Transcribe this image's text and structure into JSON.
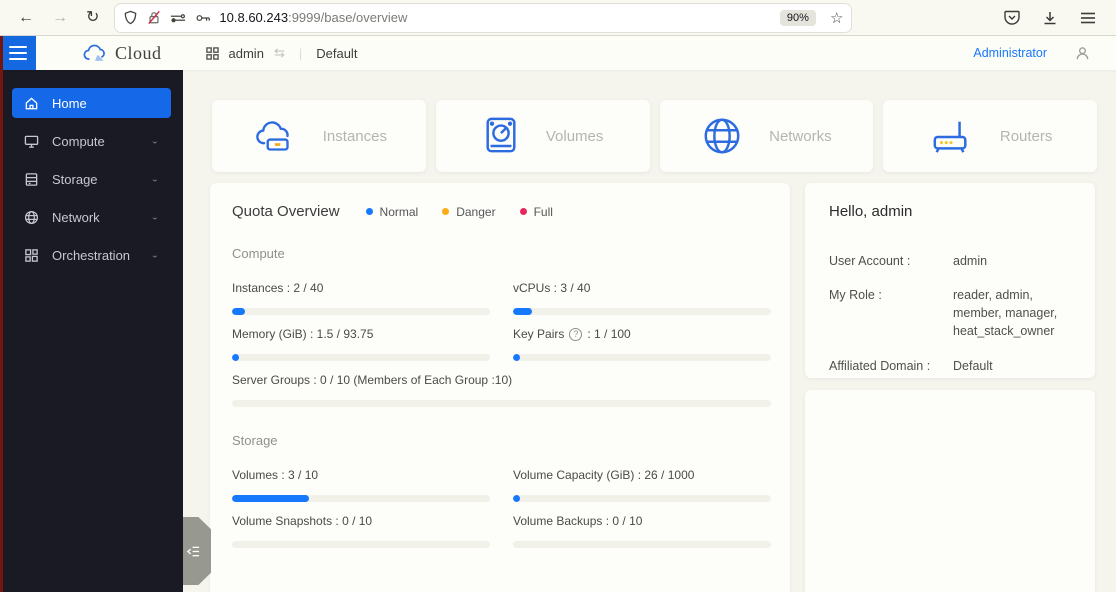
{
  "browser": {
    "url_host": "10.8.60.243",
    "url_path": ":9999/base/overview",
    "zoom_badge": "90%"
  },
  "header": {
    "logo_text": "Cloud",
    "project_name": "admin",
    "domain_name": "Default",
    "role_link": "Administrator"
  },
  "sidebar": {
    "items": [
      {
        "label": "Home",
        "icon": "home-icon",
        "active": true,
        "expandable": false
      },
      {
        "label": "Compute",
        "icon": "compute-icon",
        "active": false,
        "expandable": true
      },
      {
        "label": "Storage",
        "icon": "storage-icon",
        "active": false,
        "expandable": true
      },
      {
        "label": "Network",
        "icon": "network-icon",
        "active": false,
        "expandable": true
      },
      {
        "label": "Orchestration",
        "icon": "orchestration-icon",
        "active": false,
        "expandable": true
      }
    ]
  },
  "shortcut_cards": [
    {
      "label": "Instances",
      "icon": "instances-icon"
    },
    {
      "label": "Volumes",
      "icon": "volumes-icon"
    },
    {
      "label": "Networks",
      "icon": "networks-icon"
    },
    {
      "label": "Routers",
      "icon": "routers-icon"
    }
  ],
  "quota": {
    "title": "Quota Overview",
    "legend": [
      {
        "label": "Normal",
        "color": "#1677ff"
      },
      {
        "label": "Danger",
        "color": "#faad14"
      },
      {
        "label": "Full",
        "color": "#e5295e"
      }
    ],
    "bar_color_normal": "#1677ff",
    "sections": [
      {
        "title": "Compute",
        "items": [
          {
            "label": "Instances : 2 / 40",
            "percent": 5,
            "help": false
          },
          {
            "label": "vCPUs : 3 / 40",
            "percent": 7.5,
            "help": false
          },
          {
            "label": "Memory (GiB) : 1.5 / 93.75",
            "percent": 1.6,
            "help": false
          },
          {
            "label_pre": "Key Pairs",
            "label_post": ": 1 / 100",
            "percent": 1,
            "help": true
          },
          {
            "label": "Server Groups : 0 / 10 (Members of Each Group :10)",
            "percent": 0,
            "help": false,
            "full_width": true
          }
        ]
      },
      {
        "title": "Storage",
        "items": [
          {
            "label": "Volumes : 3 / 10",
            "percent": 30,
            "help": false
          },
          {
            "label": "Volume Capacity (GiB) : 26 / 1000",
            "percent": 2.6,
            "help": false
          },
          {
            "label": "Volume Snapshots : 0 / 10",
            "percent": 0,
            "help": false
          },
          {
            "label": "Volume Backups : 0 / 10",
            "percent": 0,
            "help": false
          }
        ]
      }
    ]
  },
  "profile": {
    "greeting": "Hello, admin",
    "rows": [
      {
        "label": "User Account :",
        "value": "admin"
      },
      {
        "label": "My Role :",
        "value": "reader, admin, member, manager, heat_stack_owner"
      },
      {
        "label": "Affiliated Domain :",
        "value": "Default"
      }
    ]
  }
}
